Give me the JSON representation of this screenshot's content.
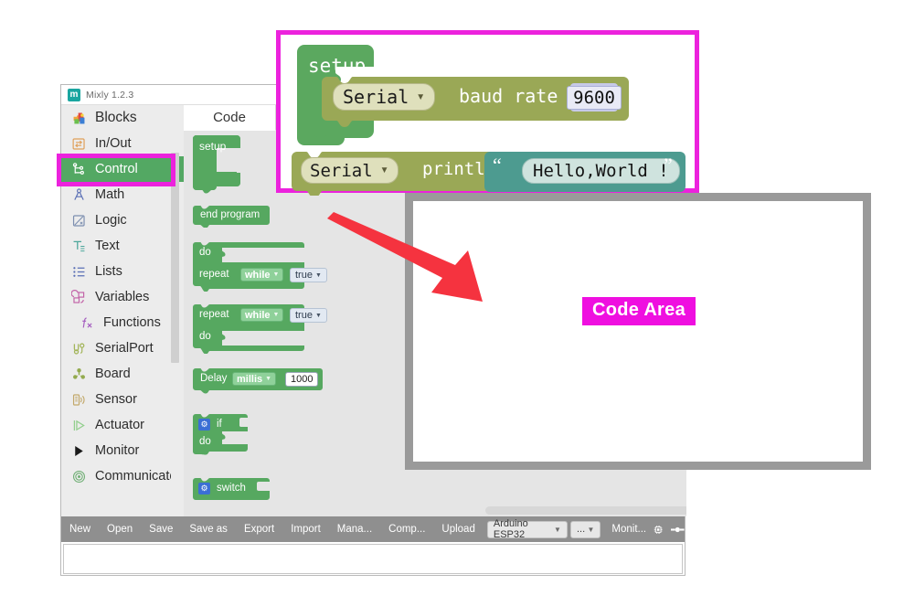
{
  "window": {
    "title": "Mixly 1.2.3",
    "logo_glyph": "m"
  },
  "tabs": [
    {
      "label": "Code"
    }
  ],
  "sidebar": {
    "items": [
      {
        "label": "Blocks",
        "icon": "puzzle-icon",
        "selected": false,
        "header": true
      },
      {
        "label": "In/Out",
        "icon": "inout-icon",
        "selected": false
      },
      {
        "label": "Control",
        "icon": "control-icon",
        "selected": true
      },
      {
        "label": "Math",
        "icon": "math-icon",
        "selected": false
      },
      {
        "label": "Logic",
        "icon": "logic-icon",
        "selected": false
      },
      {
        "label": "Text",
        "icon": "text-icon",
        "selected": false
      },
      {
        "label": "Lists",
        "icon": "lists-icon",
        "selected": false
      },
      {
        "label": "Variables",
        "icon": "variables-icon",
        "selected": false
      },
      {
        "label": "Functions",
        "icon": "functions-icon",
        "selected": false
      },
      {
        "label": "SerialPort",
        "icon": "serialport-icon",
        "selected": false
      },
      {
        "label": "Board",
        "icon": "board-icon",
        "selected": false
      },
      {
        "label": "Sensor",
        "icon": "sensor-icon",
        "selected": false
      },
      {
        "label": "Actuator",
        "icon": "actuator-icon",
        "selected": false
      },
      {
        "label": "Monitor",
        "icon": "monitor-icon",
        "selected": false
      },
      {
        "label": "Communicate",
        "icon": "communicate-icon",
        "selected": false
      }
    ]
  },
  "palette": {
    "blocks": [
      {
        "name": "setup-block",
        "label": "setup"
      },
      {
        "name": "end-program-block",
        "label": "end program"
      },
      {
        "name": "do-while-block",
        "do_label": "do",
        "repeat_label": "repeat",
        "mode": "while",
        "cond": "true"
      },
      {
        "name": "while-do-block",
        "repeat_label": "repeat",
        "mode": "while",
        "cond": "true",
        "do_label": "do"
      },
      {
        "name": "delay-block",
        "label": "Delay",
        "unit": "millis",
        "value": "1000"
      },
      {
        "name": "if-block",
        "label": "if",
        "do_label": "do"
      },
      {
        "name": "switch-block",
        "label": "switch"
      }
    ]
  },
  "snippet": {
    "setup_label": "setup",
    "baud_block": {
      "port": "Serial",
      "label": "baud rate",
      "value": "9600"
    },
    "println_block": {
      "port": "Serial",
      "label": "println",
      "quote_open": "“",
      "quote_close": "”",
      "text": "Hello,World !"
    }
  },
  "toolbar": {
    "buttons": [
      "New",
      "Open",
      "Save",
      "Save as",
      "Export",
      "Import",
      "Mana...",
      "Comp...",
      "Upload"
    ],
    "board_select": {
      "value": "Arduino ESP32"
    },
    "port_select": {
      "value": "..."
    },
    "monitor_label": "Monit...",
    "chip_icon": "chip-icon",
    "toggle_icon": "toggle-icon"
  },
  "annotations": {
    "code_area_label": "Code Area",
    "highlight_color": "#ec22dd",
    "label_bg_color": "#ef0fe0",
    "arrow_color": "#f5333f",
    "frame_color": "#9a9a9a"
  }
}
